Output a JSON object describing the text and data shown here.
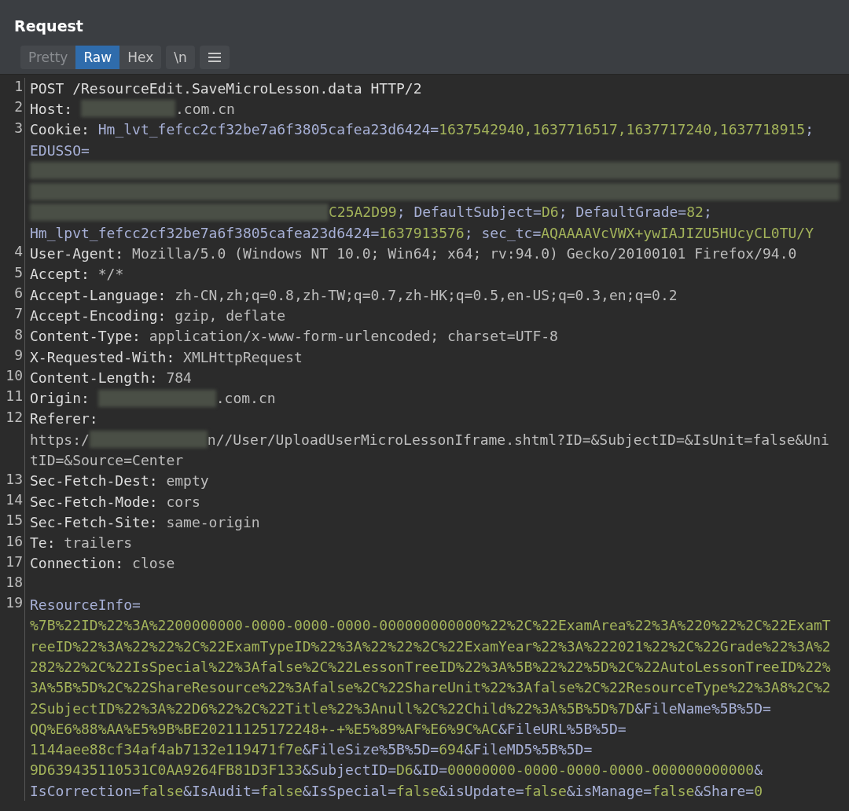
{
  "panel": {
    "title": "Request"
  },
  "view_tabs": [
    {
      "label": "Pretty",
      "selected": false
    },
    {
      "label": "Raw",
      "selected": true
    },
    {
      "label": "Hex",
      "selected": false
    }
  ],
  "newline_toggle": {
    "label": "\\n"
  },
  "lines": [
    {
      "number": "1",
      "segments": [
        {
          "kind": "header",
          "text": "POST /ResourceEdit.SaveMicroLesson.data HTTP/2"
        }
      ]
    },
    {
      "number": "2",
      "segments": [
        {
          "kind": "header",
          "text": "Host: "
        },
        {
          "kind": "redaction-short"
        },
        {
          "kind": "plain",
          "text": ".com.cn"
        }
      ]
    },
    {
      "number": "3",
      "segments": [
        {
          "kind": "header",
          "text": "Cookie: "
        },
        {
          "kind": "name",
          "text": "Hm_lvt_fefcc2cf32be7a6f3805cafea23d6424="
        },
        {
          "kind": "value",
          "text": "1637542940,1637716517,1637717240,1637718915"
        },
        {
          "kind": "name",
          "text": ";"
        }
      ]
    },
    {
      "segments": [
        {
          "kind": "name",
          "text": "EDUSSO="
        }
      ]
    },
    {
      "segments": [
        {
          "kind": "redaction-full"
        }
      ]
    },
    {
      "segments": [
        {
          "kind": "redaction-full"
        }
      ]
    },
    {
      "segments": [
        {
          "kind": "redaction-long"
        },
        {
          "kind": "value",
          "text": "C25A2D99"
        },
        {
          "kind": "name",
          "text": "; DefaultSubject="
        },
        {
          "kind": "value",
          "text": "D6"
        },
        {
          "kind": "name",
          "text": "; DefaultGrade="
        },
        {
          "kind": "value",
          "text": "82"
        },
        {
          "kind": "name",
          "text": ";"
        }
      ]
    },
    {
      "segments": [
        {
          "kind": "name",
          "text": "Hm_lpvt_fefcc2cf32be7a6f3805cafea23d6424="
        },
        {
          "kind": "value",
          "text": "1637913576"
        },
        {
          "kind": "name",
          "text": "; sec_tc="
        },
        {
          "kind": "value",
          "text": "AQAAAAVcVWX+ywIAJIZU5HUcyCL0TU/Y"
        }
      ]
    },
    {
      "number": "4",
      "segments": [
        {
          "kind": "header",
          "text": "User-Agent: "
        },
        {
          "kind": "plain",
          "text": "Mozilla/5.0 (Windows NT 10.0; Win64; x64; rv:94.0) Gecko/20100101 Firefox/94.0"
        }
      ]
    },
    {
      "number": "5",
      "segments": [
        {
          "kind": "header",
          "text": "Accept: "
        },
        {
          "kind": "plain",
          "text": "*/*"
        }
      ]
    },
    {
      "number": "6",
      "segments": [
        {
          "kind": "header",
          "text": "Accept-Language: "
        },
        {
          "kind": "plain",
          "text": "zh-CN,zh;q=0.8,zh-TW;q=0.7,zh-HK;q=0.5,en-US;q=0.3,en;q=0.2"
        }
      ]
    },
    {
      "number": "7",
      "segments": [
        {
          "kind": "header",
          "text": "Accept-Encoding: "
        },
        {
          "kind": "plain",
          "text": "gzip, deflate"
        }
      ]
    },
    {
      "number": "8",
      "segments": [
        {
          "kind": "header",
          "text": "Content-Type: "
        },
        {
          "kind": "plain",
          "text": "application/x-www-form-urlencoded; charset=UTF-8"
        }
      ]
    },
    {
      "number": "9",
      "segments": [
        {
          "kind": "header",
          "text": "X-Requested-With: "
        },
        {
          "kind": "plain",
          "text": "XMLHttpRequest"
        }
      ]
    },
    {
      "number": "10",
      "segments": [
        {
          "kind": "header",
          "text": "Content-Length: "
        },
        {
          "kind": "plain",
          "text": "784"
        }
      ]
    },
    {
      "number": "11",
      "segments": [
        {
          "kind": "header",
          "text": "Origin: "
        },
        {
          "kind": "redaction-medium"
        },
        {
          "kind": "plain",
          "text": ".com.cn"
        }
      ]
    },
    {
      "number": "12",
      "segments": [
        {
          "kind": "header",
          "text": "Referer:"
        }
      ]
    },
    {
      "segments": [
        {
          "kind": "plain",
          "text": "https:/"
        },
        {
          "kind": "redaction-medium"
        },
        {
          "kind": "plain",
          "text": "n//User/UploadUserMicroLessonIframe.shtml?ID=&SubjectID=&IsUnit=false&Uni"
        }
      ]
    },
    {
      "segments": [
        {
          "kind": "plain",
          "text": "tID=&Source=Center"
        }
      ]
    },
    {
      "number": "13",
      "segments": [
        {
          "kind": "header",
          "text": "Sec-Fetch-Dest: "
        },
        {
          "kind": "plain",
          "text": "empty"
        }
      ]
    },
    {
      "number": "14",
      "segments": [
        {
          "kind": "header",
          "text": "Sec-Fetch-Mode: "
        },
        {
          "kind": "plain",
          "text": "cors"
        }
      ]
    },
    {
      "number": "15",
      "segments": [
        {
          "kind": "header",
          "text": "Sec-Fetch-Site: "
        },
        {
          "kind": "plain",
          "text": "same-origin"
        }
      ]
    },
    {
      "number": "16",
      "segments": [
        {
          "kind": "header",
          "text": "Te: "
        },
        {
          "kind": "plain",
          "text": "trailers"
        }
      ]
    },
    {
      "number": "17",
      "segments": [
        {
          "kind": "header",
          "text": "Connection: "
        },
        {
          "kind": "plain",
          "text": "close"
        }
      ]
    },
    {
      "number": "18"
    },
    {
      "number": "19",
      "segments": [
        {
          "kind": "name",
          "text": "ResourceInfo="
        }
      ]
    },
    {
      "segments": [
        {
          "kind": "value",
          "text": "%7B%22ID%22%3A%2200000000-0000-0000-0000-000000000000%22%2C%22ExamArea%22%3A%220%22%2C%22ExamT"
        }
      ]
    },
    {
      "segments": [
        {
          "kind": "value",
          "text": "reeID%22%3A%22%22%2C%22ExamTypeID%22%3A%22%22%2C%22ExamYear%22%3A%222021%22%2C%22Grade%22%3A%2"
        }
      ]
    },
    {
      "segments": [
        {
          "kind": "value",
          "text": "282%22%2C%22IsSpecial%22%3Afalse%2C%22LessonTreeID%22%3A%5B%22%22%5D%2C%22AutoLessonTreeID%22%"
        }
      ]
    },
    {
      "segments": [
        {
          "kind": "value",
          "text": "3A%5B%5D%2C%22ShareResource%22%3Afalse%2C%22ShareUnit%22%3Afalse%2C%22ResourceType%22%3A8%2C%2"
        }
      ]
    },
    {
      "segments": [
        {
          "kind": "value",
          "text": "2SubjectID%22%3A%22D6%22%2C%22Title%22%3Anull%2C%22Child%22%3A%5B%5D%7D"
        },
        {
          "kind": "name",
          "text": "&FileName%5B%5D="
        }
      ]
    },
    {
      "segments": [
        {
          "kind": "value",
          "text": "QQ%E6%88%AA%E5%9B%BE20211125172248+-+%E5%89%AF%E6%9C%AC"
        },
        {
          "kind": "name",
          "text": "&FileURL%5B%5D="
        }
      ]
    },
    {
      "segments": [
        {
          "kind": "value",
          "text": "1144aee88cf34af4ab7132e119471f7e"
        },
        {
          "kind": "name",
          "text": "&FileSize%5B%5D="
        },
        {
          "kind": "value",
          "text": "694"
        },
        {
          "kind": "name",
          "text": "&FileMD5%5B%5D="
        }
      ]
    },
    {
      "segments": [
        {
          "kind": "value",
          "text": "9D639435110531C0AA9264FB81D3F133"
        },
        {
          "kind": "name",
          "text": "&SubjectID="
        },
        {
          "kind": "value",
          "text": "D6"
        },
        {
          "kind": "name",
          "text": "&ID="
        },
        {
          "kind": "value",
          "text": "00000000-0000-0000-0000-000000000000"
        },
        {
          "kind": "name",
          "text": "&"
        }
      ]
    },
    {
      "segments": [
        {
          "kind": "name",
          "text": "IsCorrection="
        },
        {
          "kind": "value",
          "text": "false"
        },
        {
          "kind": "name",
          "text": "&IsAudit="
        },
        {
          "kind": "value",
          "text": "false"
        },
        {
          "kind": "name",
          "text": "&IsSpecial="
        },
        {
          "kind": "value",
          "text": "false"
        },
        {
          "kind": "name",
          "text": "&isUpdate="
        },
        {
          "kind": "value",
          "text": "false"
        },
        {
          "kind": "name",
          "text": "&isManage="
        },
        {
          "kind": "value",
          "text": "false"
        },
        {
          "kind": "name",
          "text": "&Share="
        },
        {
          "kind": "value",
          "text": "0"
        }
      ]
    }
  ]
}
